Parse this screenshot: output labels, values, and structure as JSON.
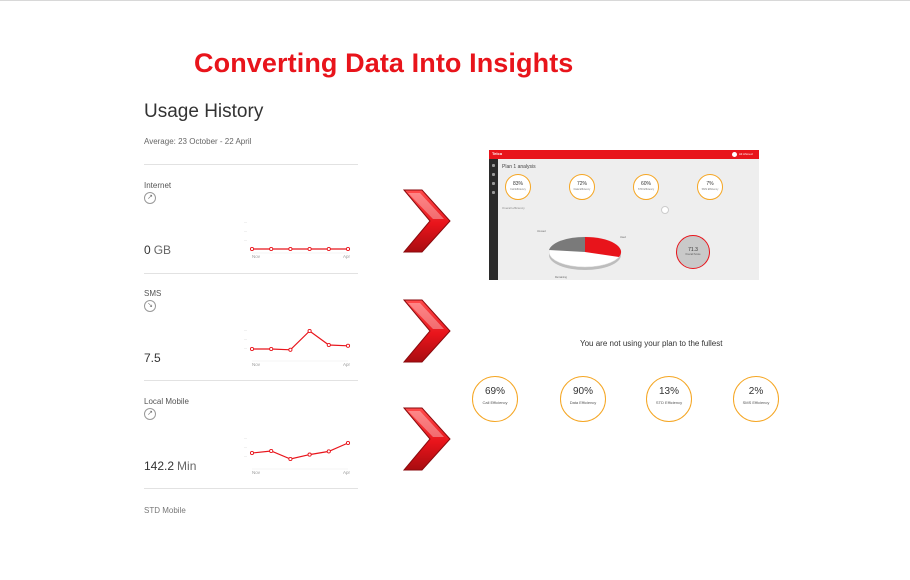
{
  "title": "Converting Data Into Insights",
  "usage": {
    "heading": "Usage History",
    "average": "Average: 23 October - 22 April",
    "sections": [
      {
        "label": "Internet",
        "trend_icon": "trend-up-icon",
        "value": "0",
        "unit": "GB",
        "x_start": "Nov",
        "x_end": "Apr",
        "series": [
          0,
          0,
          0,
          0,
          0,
          0
        ]
      },
      {
        "label": "SMS",
        "trend_icon": "trend-down-icon",
        "value": "7.5",
        "unit": "",
        "x_start": "Nov",
        "x_end": "Apr",
        "series": [
          2,
          2,
          1.8,
          6.5,
          3,
          2.8
        ]
      },
      {
        "label": "Local Mobile",
        "trend_icon": "trend-up-icon",
        "value": "142.2",
        "unit": "Min",
        "x_start": "Nov",
        "x_end": "Apr",
        "series": [
          3,
          3.5,
          1.5,
          2.6,
          3.4,
          5.5
        ]
      }
    ],
    "next_label": "STD Mobile"
  },
  "dashboard": {
    "brand": "Telco",
    "user_name": "Ali Ahmed",
    "title": "Plan 1 analysis",
    "subtitle": "Overall efficiency",
    "metrics": [
      {
        "percent": "83%",
        "label": "Call Efficiency"
      },
      {
        "percent": "72%",
        "label": "Data Efficiency"
      },
      {
        "percent": "60%",
        "label": "STD Efficiency"
      },
      {
        "percent": "7%",
        "label": "SMS Efficiency"
      }
    ],
    "pie_labels": {
      "used": "Used",
      "unused": "Unused",
      "remaining": "Remaining"
    },
    "score": {
      "value": "71.3",
      "label": "Overall Score"
    }
  },
  "efficiency": {
    "note": "You are not using your plan to the fullest",
    "items": [
      {
        "percent": "69%",
        "label": "Call Efficiency"
      },
      {
        "percent": "90%",
        "label": "Data Efficiency"
      },
      {
        "percent": "13%",
        "label": "STD Efficiency"
      },
      {
        "percent": "2%",
        "label": "SMS Efficiency"
      }
    ]
  },
  "colors": {
    "accent": "#e8141b",
    "ring": "#f5a623",
    "sidebar": "#2b2b2b"
  }
}
